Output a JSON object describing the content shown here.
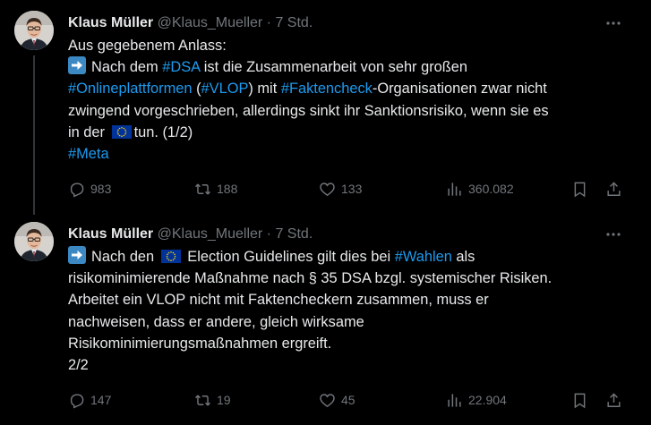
{
  "tweets": [
    {
      "author_name": "Klaus Müller",
      "handle": "@Klaus_Mueller",
      "separator": "·",
      "time": "7 Std.",
      "text": {
        "l1": "Aus gegebenem Anlass:",
        "l2_a": "Nach dem",
        "l2_tag": "#DSA",
        "l2_b": "ist die Zusammenarbeit von sehr großen",
        "l3_tag1": "#Onlineplattformen",
        "l3_a": "(",
        "l3_tag2": "#VLOP",
        "l3_b": ") mit",
        "l3_tag3": "#Faktencheck",
        "l3_c": "-Organisationen zwar nicht",
        "l4": "zwingend vorgeschrieben, allerdings sinkt ihr Sanktionsrisiko, wenn sie es",
        "l5_a": "in der",
        "l5_b": "tun. (1/2)",
        "l6_tag": "#Meta"
      },
      "stats": {
        "replies": "983",
        "retweets": "188",
        "likes": "133",
        "views": "360.082"
      }
    },
    {
      "author_name": "Klaus Müller",
      "handle": "@Klaus_Mueller",
      "separator": "·",
      "time": "7 Std.",
      "text": {
        "l1_a": "Nach den",
        "l1_b": "Election Guidelines gilt dies bei",
        "l1_tag": "#Wahlen",
        "l1_c": "als",
        "l2": "risikominimierende Maßnahme nach § 35 DSA bzgl. systemischer Risiken.",
        "l3": "Arbeitet ein VLOP nicht mit Faktencheckern zusammen, muss er",
        "l4": "nachweisen, dass er andere, gleich wirksame",
        "l5": "Risikominimierungsmaßnahmen ergreift.",
        "l6": "2/2"
      },
      "stats": {
        "replies": "147",
        "retweets": "19",
        "likes": "45",
        "views": "22.904"
      }
    }
  ],
  "colors": {
    "background": "#000000",
    "text": "#e7e9ea",
    "muted": "#71767b",
    "link": "#1d9bf0",
    "thread_line": "#333639"
  },
  "icons": [
    "reply-icon",
    "retweet-icon",
    "like-icon",
    "views-icon",
    "bookmark-icon",
    "share-icon",
    "more-icon",
    "arrow-right-emoji",
    "eu-flag-emoji"
  ]
}
